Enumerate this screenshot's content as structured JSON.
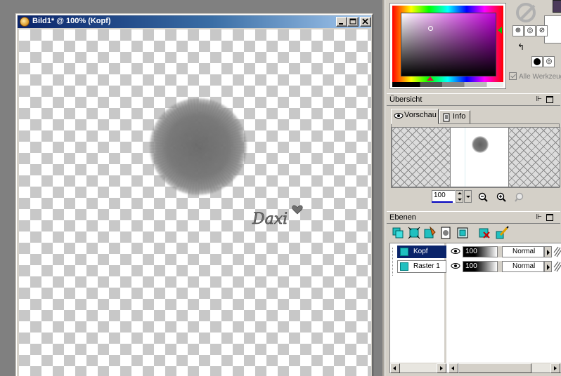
{
  "document": {
    "title": "Bild1* @ 100% (Kopf)",
    "watermark_text": "Daxi"
  },
  "materials": {
    "all_tools_label": "Alle Werkzeuge"
  },
  "overview": {
    "title": "Übersicht",
    "tabs": [
      {
        "label": "Vorschau",
        "icon": "eye-icon"
      },
      {
        "label": "Info",
        "icon": "document-icon"
      }
    ],
    "zoom_value": "100"
  },
  "layers": {
    "title": "Ebenen",
    "items": [
      {
        "name": "Kopf",
        "opacity": "100",
        "blend_mode": "Normal",
        "selected": true
      },
      {
        "name": "Raster 1",
        "opacity": "100",
        "blend_mode": "Normal",
        "selected": false
      }
    ]
  },
  "colors": {
    "titlebar_start": "#0a246a",
    "titlebar_end": "#a6caf0",
    "panel_bg": "#d4d0c8",
    "selection": "#0a246a",
    "layer_thumb": "#20c0c0"
  }
}
